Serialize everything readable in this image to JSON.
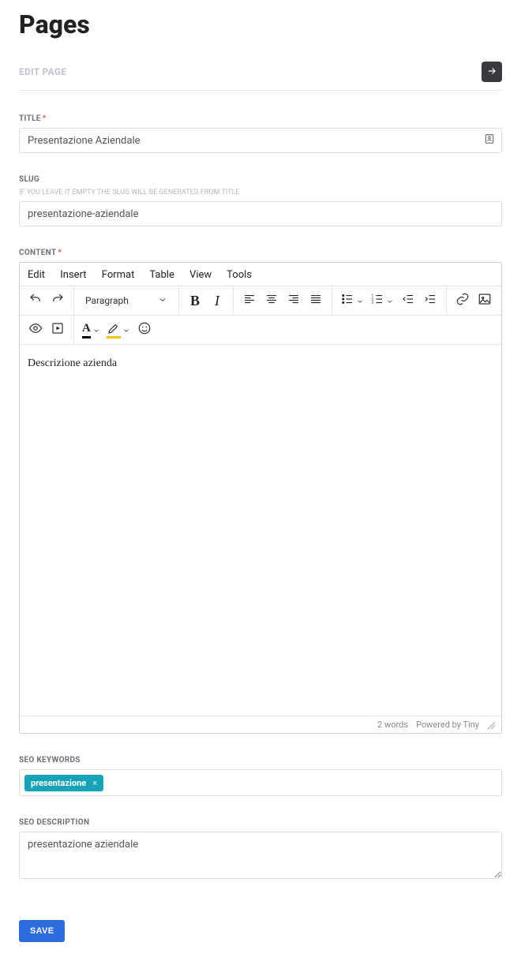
{
  "page_heading": "Pages",
  "section_label": "EDIT PAGE",
  "fields": {
    "title": {
      "label": "TITLE",
      "required": "*",
      "value": "Presentazione Aziendale"
    },
    "slug": {
      "label": "SLUG",
      "hint": "IF YOU LEAVE IT EMPTY THE SLUG WILL BE GENERATED FROM TITLE",
      "value": "presentazione-aziendale"
    },
    "content": {
      "label": "CONTENT",
      "required": "*",
      "menubar": {
        "edit": "Edit",
        "insert": "Insert",
        "format": "Format",
        "table": "Table",
        "view": "View",
        "tools": "Tools"
      },
      "format_select": "Paragraph",
      "body": "Descrizione azienda",
      "status_words": "2 words",
      "status_powered": "Powered by Tiny"
    },
    "seo_keywords": {
      "label": "SEO KEYWORDS",
      "tags": [
        "presentazione"
      ]
    },
    "seo_description": {
      "label": "SEO DESCRIPTION",
      "value": "presentazione aziendale"
    }
  },
  "buttons": {
    "save": "SAVE",
    "tag_remove": "×"
  }
}
